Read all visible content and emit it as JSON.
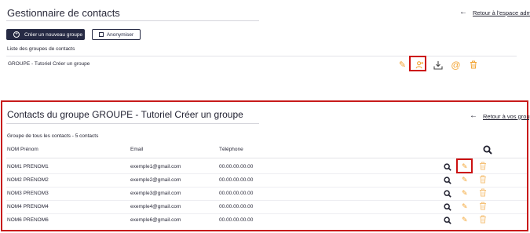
{
  "header": {
    "title": "Gestionnaire de contacts",
    "back_link": "Retour à l'espace admin",
    "back_arrow": "←"
  },
  "actions": {
    "create_group": "Créer un nouveau groupe",
    "anonymize": "Anonymiser"
  },
  "group_list": {
    "title": "Liste des groupes de contacts",
    "groups": [
      {
        "label": "GROUPE - Tutoriel Créer un groupe"
      }
    ],
    "icons": [
      "pencil-icon",
      "contacts-icon",
      "download-icon",
      "at-icon",
      "trash-icon"
    ]
  },
  "contacts_panel": {
    "title": "Contacts du groupe GROUPE - Tutoriel Créer un groupe",
    "back_link": "Retour à vos groupes",
    "back_arrow": "←",
    "subtitle": "Groupe de tous les contacts - 5 contacts",
    "columns": [
      "NOM Prénom",
      "Email",
      "Téléphone"
    ],
    "rows": [
      {
        "name": "NOM1 PRENOM1",
        "email": "exemple1@gmail.com",
        "phone": "00.00.00.00.00"
      },
      {
        "name": "NOM2 PRENOM2",
        "email": "exemple2@gmail.com",
        "phone": "00.00.00.00.00"
      },
      {
        "name": "NOM3 PRENOM3",
        "email": "exemple3@gmail.com",
        "phone": "00.00.00.00.00"
      },
      {
        "name": "NOM4 PRENOM4",
        "email": "exemple4@gmail.com",
        "phone": "00.00.00.00.00"
      },
      {
        "name": "NOM6 PRENOM6",
        "email": "exemple6@gmail.com",
        "phone": "00.00.00.00.00"
      }
    ]
  },
  "colors": {
    "primary": "#262a44",
    "accent_orange": "#f3a433",
    "highlight_red": "#c81b1b"
  }
}
